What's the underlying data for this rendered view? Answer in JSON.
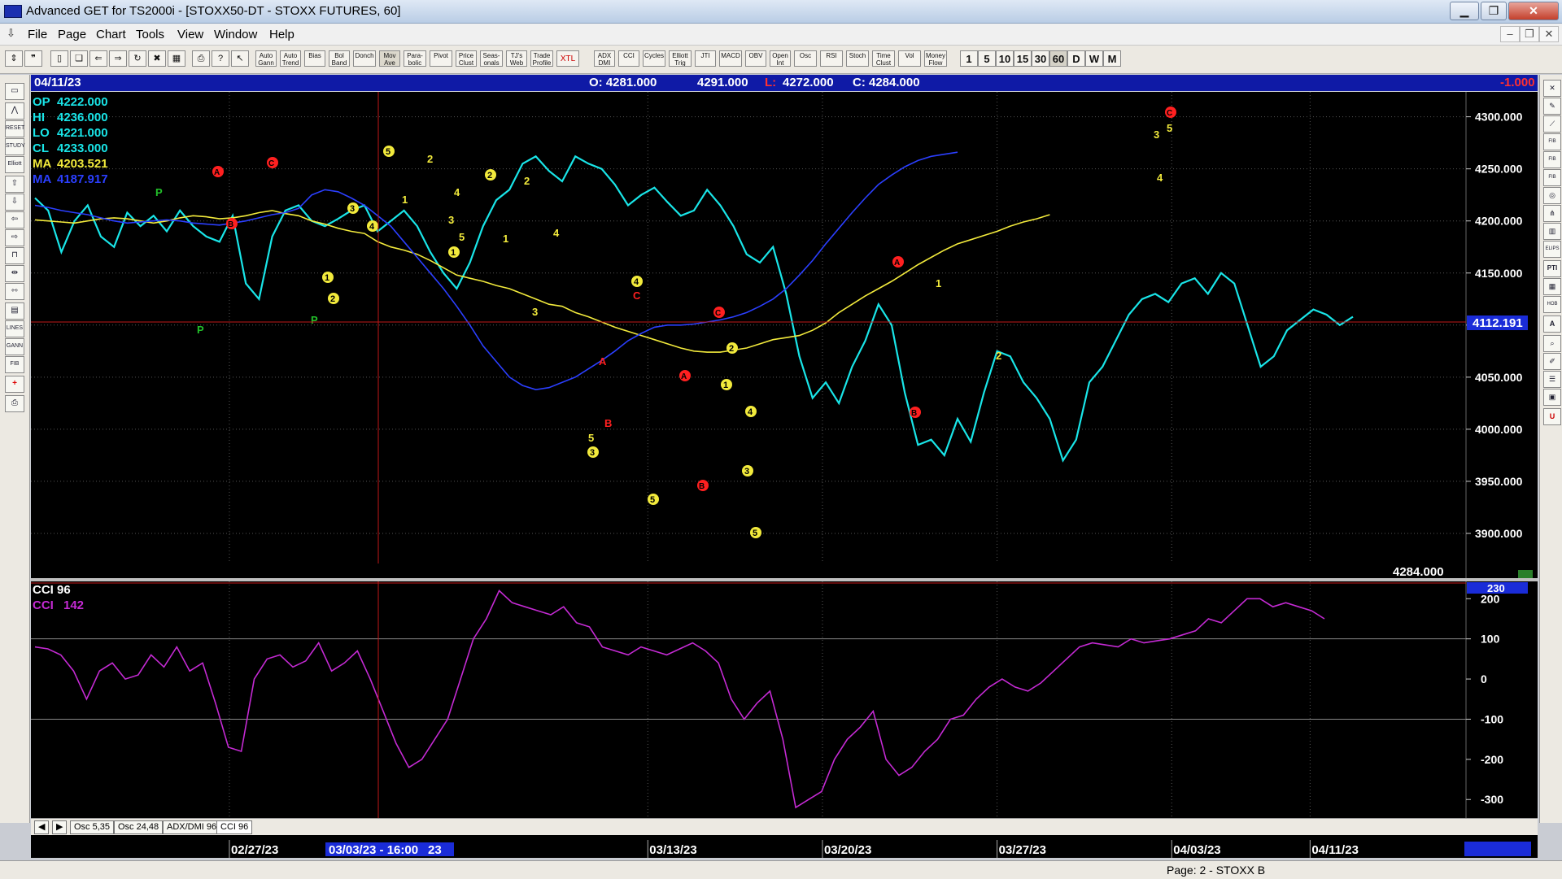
{
  "window": {
    "title": "Advanced GET for TS2000i - [STOXX50-DT - STOXX FUTURES, 60]"
  },
  "menu": [
    "File",
    "Page",
    "Chart",
    "Tools",
    "View",
    "Window",
    "Help"
  ],
  "toolbar": {
    "buttons": [
      "Auto Gann",
      "Auto Trend",
      "Bias",
      "Bol Band",
      "Donch",
      "Mov Ave",
      "Para-bolic",
      "Pivot",
      "Price Clust",
      "Seas-onals",
      "TJ's Web",
      "Trade Profile",
      "XTL",
      "ADX DMI",
      "CCI",
      "Cycles",
      "Elliott Trig",
      "JTI",
      "MACD",
      "OBV",
      "Open Int",
      "Osc",
      "RSI",
      "Stoch",
      "Time Clust",
      "Vol",
      "Money Flow"
    ],
    "timeframes": [
      "1",
      "5",
      "10",
      "15",
      "30",
      "60",
      "D",
      "W",
      "M"
    ],
    "active_timeframe": "60"
  },
  "left_tools": [
    "Elliott",
    "RESET",
    "STUDY",
    "LINES",
    "GANN",
    "FIB"
  ],
  "right_tools": [
    "FIB RET",
    "FIB EXT",
    "FIB TIME",
    "ELIPS",
    "PTI",
    "HOB"
  ],
  "price_header": {
    "date": "04/11/23",
    "open": "O: 4281.000",
    "high": "4291.000",
    "low_label": "L:",
    "low": "4272.000",
    "close": "C: 4284.000",
    "change": "-1.000"
  },
  "readout": [
    {
      "label": "OP",
      "value": "4222.000",
      "color": "#19e5e8"
    },
    {
      "label": "HI",
      "value": "4236.000",
      "color": "#19e5e8"
    },
    {
      "label": "LO",
      "value": "4221.000",
      "color": "#19e5e8"
    },
    {
      "label": "CL",
      "value": "4233.000",
      "color": "#19e5e8"
    },
    {
      "label": "MA",
      "value": "4203.521",
      "color": "#f2ea3c"
    },
    {
      "label": "MA",
      "value": "4187.917",
      "color": "#2b3fff"
    }
  ],
  "cursor_price_label": "4112.191",
  "last_price_label": "4284.000",
  "cci_panel": {
    "title": "CCI 96",
    "value_label": "CCI",
    "value": "142",
    "top_label": "230"
  },
  "tabs": [
    "Osc 5,35",
    "Osc 24,48",
    "ADX/DMI 96",
    "CCI 96"
  ],
  "active_tab": "CCI 96",
  "date_axis": {
    "labels": [
      "02/27/23",
      "03/13/23",
      "03/20/23",
      "03/27/23",
      "04/03/23",
      "04/11/23"
    ],
    "cursor_label": "03/03/23 - 16:00",
    "cursor_suffix": "23"
  },
  "status": {
    "page": "Page: 2 - STOXX B"
  },
  "chart_data": [
    {
      "type": "line",
      "title": "STOXX50-DT - STOXX FUTURES, 60",
      "y_ticks": [
        3900,
        3950,
        4000,
        4050,
        4100,
        4150,
        4200,
        4250,
        4300
      ],
      "ylim": [
        3875,
        4320
      ],
      "x": [
        0,
        4,
        8,
        12,
        16,
        20,
        24,
        28,
        32,
        36,
        40,
        44,
        48,
        52,
        56,
        60,
        64,
        68,
        72,
        76,
        80,
        84,
        88,
        92,
        96,
        100,
        104,
        108,
        112,
        116,
        120,
        124,
        128,
        132,
        136,
        140,
        144,
        148,
        152,
        156,
        160,
        164,
        168,
        172,
        176,
        180,
        184,
        188,
        192,
        196,
        200,
        204,
        208,
        212,
        216,
        220,
        224,
        228,
        232,
        236,
        240,
        244,
        248,
        252,
        256,
        260,
        264,
        268,
        272,
        276,
        280,
        284,
        288,
        292,
        296,
        300,
        304,
        308,
        312,
        316,
        320,
        324,
        328,
        332,
        336,
        340,
        344,
        348,
        352,
        356,
        360,
        364,
        368,
        372,
        376,
        380,
        384,
        388,
        392,
        396,
        400
      ],
      "x_ticks": [
        {
          "at": 59,
          "label": "02/27/23"
        },
        {
          "at": 186,
          "label": "03/13/23"
        },
        {
          "at": 239,
          "label": "03/20/23"
        },
        {
          "at": 292,
          "label": "03/27/23"
        },
        {
          "at": 345,
          "label": "04/03/23"
        },
        {
          "at": 387,
          "label": "04/11/23"
        }
      ],
      "series": [
        {
          "name": "Price",
          "color": "#19e5e8",
          "values": [
            4222,
            4210,
            4170,
            4200,
            4215,
            4185,
            4175,
            4208,
            4195,
            4205,
            4190,
            4210,
            4195,
            4185,
            4180,
            4205,
            4140,
            4125,
            4185,
            4210,
            4215,
            4200,
            4195,
            4202,
            4210,
            4215,
            4190,
            4200,
            4210,
            4195,
            4170,
            4150,
            4135,
            4160,
            4195,
            4220,
            4230,
            4255,
            4262,
            4248,
            4238,
            4262,
            4255,
            4250,
            4235,
            4215,
            4225,
            4232,
            4218,
            4205,
            4210,
            4230,
            4215,
            4195,
            4168,
            4160,
            4175,
            4130,
            4070,
            4030,
            4045,
            4025,
            4060,
            4085,
            4120,
            4100,
            4035,
            3985,
            3990,
            3975,
            4010,
            3988,
            4035,
            4075,
            4070,
            4045,
            4030,
            4010,
            3970,
            3990,
            4045,
            4060,
            4085,
            4110,
            4125,
            4130,
            4122,
            4140,
            4145,
            4130,
            4150,
            4140,
            4100,
            4060,
            4070,
            4095,
            4105,
            4115,
            4110,
            4100,
            4108
          ]
        },
        {
          "name": "MA",
          "color": "#f2ea3c",
          "values": [
            4201,
            4200,
            4199,
            4198,
            4200,
            4202,
            4203,
            4202,
            4200,
            4198,
            4200,
            4203,
            4205,
            4204,
            4202,
            4203,
            4205,
            4208,
            4210,
            4207,
            4205,
            4200,
            4197,
            4193,
            4190,
            4188,
            4180,
            4175,
            4172,
            4168,
            4162,
            4155,
            4148,
            4145,
            4142,
            4138,
            4135,
            4130,
            4125,
            4120,
            4118,
            4112,
            4108,
            4103,
            4098,
            4094,
            4090,
            4086,
            4082,
            4078,
            4075,
            4074,
            4074,
            4076,
            4078,
            4082,
            4086,
            4088,
            4090,
            4095,
            4102,
            4112,
            4120,
            4128,
            4135,
            4142,
            4150,
            4158,
            4165,
            4172,
            4178,
            4182,
            4186,
            4190,
            4195,
            4199,
            4202,
            4206
          ]
        },
        {
          "name": "MA",
          "color": "#2b3fff",
          "values": [
            4215,
            4213,
            4210,
            4208,
            4206,
            4203,
            4200,
            4198,
            4199,
            4200,
            4201,
            4200,
            4198,
            4197,
            4196,
            4198,
            4200,
            4203,
            4206,
            4208,
            4212,
            4225,
            4230,
            4228,
            4222,
            4215,
            4205,
            4195,
            4180,
            4165,
            4150,
            4135,
            4118,
            4100,
            4080,
            4065,
            4050,
            4042,
            4038,
            4040,
            4045,
            4050,
            4058,
            4066,
            4075,
            4085,
            4092,
            4098,
            4100,
            4100,
            4101,
            4103,
            4105,
            4108,
            4112,
            4118,
            4125,
            4135,
            4148,
            4162,
            4178,
            4193,
            4208,
            4222,
            4235,
            4244,
            4252,
            4258,
            4262,
            4264,
            4266
          ]
        }
      ]
    },
    {
      "type": "line",
      "title": "CCI 96",
      "y_ticks": [
        -300,
        -200,
        -100,
        0,
        100,
        200
      ],
      "ylim": [
        -340,
        235
      ],
      "series": [
        {
          "name": "CCI",
          "color": "#c42ad3",
          "values": [
            80,
            75,
            60,
            20,
            -50,
            20,
            40,
            0,
            10,
            60,
            30,
            80,
            20,
            40,
            -60,
            -170,
            -180,
            0,
            50,
            60,
            30,
            45,
            90,
            20,
            40,
            70,
            0,
            -80,
            -160,
            -220,
            -200,
            -150,
            -100,
            0,
            100,
            150,
            220,
            190,
            180,
            170,
            160,
            180,
            140,
            130,
            80,
            70,
            60,
            80,
            70,
            60,
            75,
            90,
            70,
            40,
            -50,
            -100,
            -60,
            -30,
            -150,
            -320,
            -300,
            -280,
            -200,
            -150,
            -120,
            -80,
            -200,
            -240,
            -220,
            -180,
            -150,
            -100,
            -90,
            -50,
            -20,
            0,
            -20,
            -30,
            -10,
            20,
            50,
            80,
            90,
            85,
            80,
            100,
            90,
            95,
            100,
            110,
            120,
            150,
            140,
            170,
            200,
            200,
            180,
            190,
            180,
            170,
            150
          ]
        }
      ]
    }
  ]
}
